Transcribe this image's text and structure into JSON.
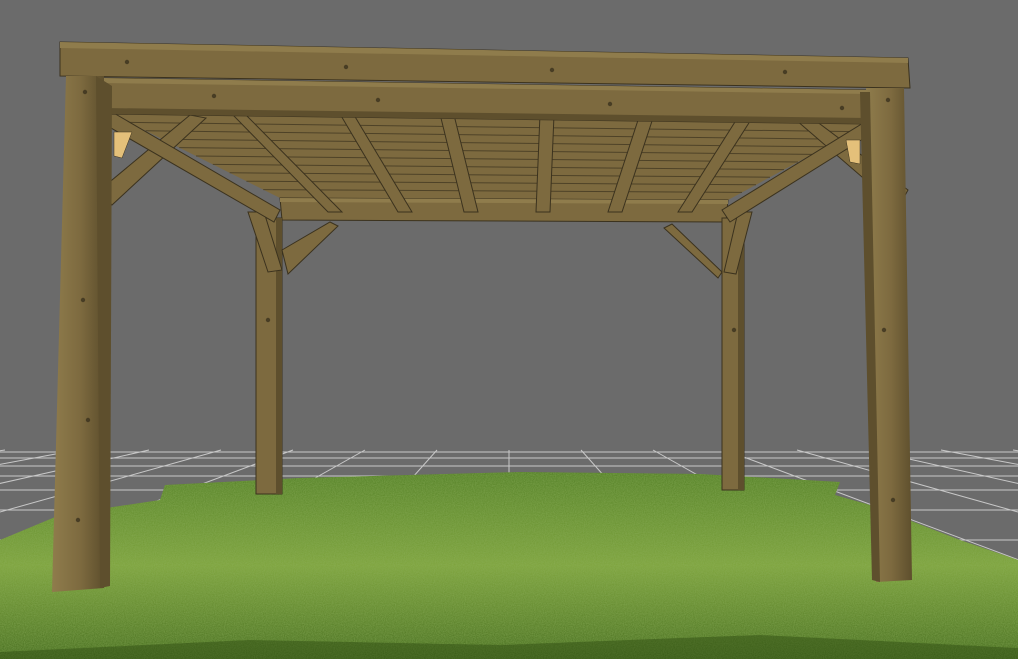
{
  "viewport": {
    "background_color": "#6b6b6b",
    "grid_color": "#c8c8c8"
  },
  "scene": {
    "ground": {
      "colors": [
        "#4f7c22",
        "#7da33a",
        "#3e6518"
      ]
    },
    "structure": {
      "type": "timber pergola",
      "wood_colors": {
        "face": "#7d6a3f",
        "light": "#8f7c4c",
        "shade": "#5e4f2d",
        "edge": "#3b321e",
        "end_grain": "#e4c07a"
      },
      "rafter_count": 6,
      "ceiling_board_count": 10
    }
  }
}
